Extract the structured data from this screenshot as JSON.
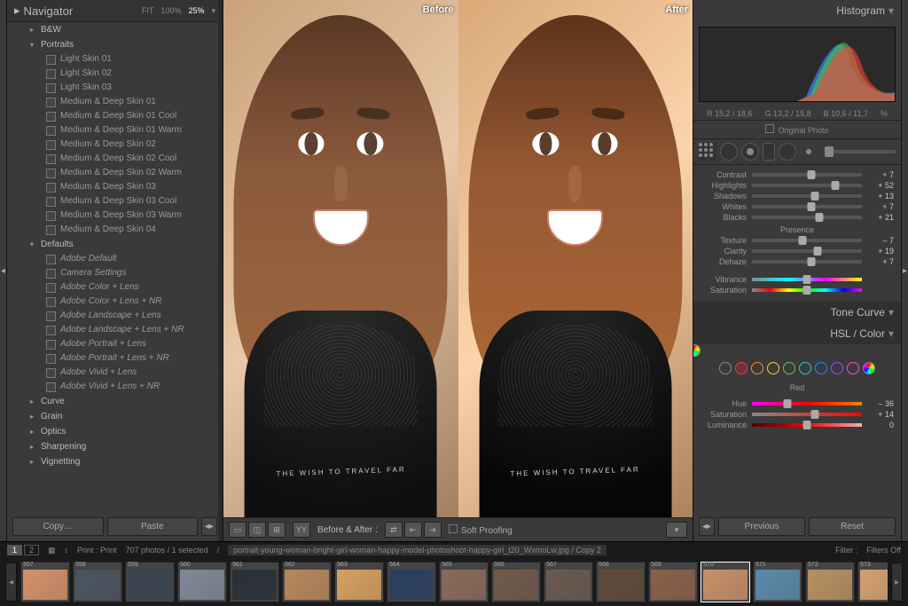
{
  "navigator": {
    "title": "Navigator",
    "zoom": {
      "fit": "FIT",
      "z100": "100%",
      "z25": "25%",
      "active": "25%"
    }
  },
  "presets": {
    "bw_section": "B&W",
    "portraits_section": "Portraits",
    "portraits": [
      "Light Skin 01",
      "Light Skin 02",
      "Light Skin 03",
      "Medium & Deep Skin 01",
      "Medium & Deep Skin 01 Cool",
      "Medium & Deep Skin 01 Warm",
      "Medium & Deep Skin 02",
      "Medium & Deep Skin 02 Cool",
      "Medium & Deep Skin 02 Warm",
      "Medium & Deep Skin 03",
      "Medium & Deep Skin 03 Cool",
      "Medium & Deep Skin 03 Warm",
      "Medium & Deep Skin 04"
    ],
    "defaults_section": "Defaults",
    "defaults": [
      "Adobe Default",
      "Camera Settings",
      "Adobe Color + Lens",
      "Adobe Color + Lens + NR",
      "Adobe Landscape + Lens",
      "Adobe Landscape + Lens + NR",
      "Adobe Portrait + Lens",
      "Adobe Portrait + Lens + NR",
      "Adobe Vivid + Lens",
      "Adobe Vivid + Lens + NR"
    ],
    "collapsed": [
      "Curve",
      "Grain",
      "Optics",
      "Sharpening",
      "Vignetting"
    ]
  },
  "left_buttons": {
    "copy": "Copy…",
    "paste": "Paste"
  },
  "compare": {
    "before": "Before",
    "after": "After",
    "shirt_text": "THE WISH TO TRAVEL FAR"
  },
  "bottom_toolbar": {
    "ba_label": "Before & After :",
    "soft_proof": "Soft Proofing"
  },
  "right": {
    "histogram_title": "Histogram",
    "hist_stats": {
      "r": "R  15,2 / 18,6",
      "g": "G  13,2 / 15,8",
      "b": "B  10,6 / 11,7",
      "pct": "%"
    },
    "original_photo": "Original Photo",
    "basic_sliders": [
      {
        "label": "Contrast",
        "val": "+ 7",
        "pos": 54
      },
      {
        "label": "Highlights",
        "val": "+ 52",
        "pos": 76
      },
      {
        "label": "Shadows",
        "val": "+ 13",
        "pos": 57
      },
      {
        "label": "Whites",
        "val": "+ 7",
        "pos": 54
      },
      {
        "label": "Blacks",
        "val": "+ 21",
        "pos": 61
      }
    ],
    "presence_label": "Presence",
    "presence_sliders": [
      {
        "label": "Texture",
        "val": "– 7",
        "pos": 46
      },
      {
        "label": "Clarity",
        "val": "+ 19",
        "pos": 60
      },
      {
        "label": "Dehaze",
        "val": "+ 7",
        "pos": 54
      }
    ],
    "color_sliders": [
      {
        "label": "Vibrance",
        "val": "",
        "pos": 50,
        "cls": "grad-vib"
      },
      {
        "label": "Saturation",
        "val": "",
        "pos": 50,
        "cls": "grad-sat"
      }
    ],
    "tone_curve_title": "Tone Curve",
    "hsl_title": "HSL / Color",
    "hsl_channel": "Red",
    "hsl_sliders": [
      {
        "label": "Hue",
        "val": "– 36",
        "pos": 32,
        "cls": "grad-hue"
      },
      {
        "label": "Saturation",
        "val": "+ 14",
        "pos": 57,
        "cls": "grad-satR"
      },
      {
        "label": "Luminance",
        "val": "0",
        "pos": 50,
        "cls": "grad-lumR"
      }
    ],
    "prev_btn": "Previous",
    "reset_btn": "Reset"
  },
  "status": {
    "page1": "1",
    "page2": "2",
    "breadcrumb": "Print : Print",
    "count": "707 photos / 1 selected",
    "path": "portrait-young-woman-bright-girl-woman-happy-model-photoshoot-happy-girl_t20_WxmoLw.jpg / Copy 2",
    "filter_label": "Filter :",
    "filter_value": "Filters Off"
  },
  "filmstrip": {
    "start": 557,
    "selected": 570
  },
  "hsl_colors": [
    "#ff3030",
    "#ff8c1a",
    "#ffd21a",
    "#46d246",
    "#1ad2d2",
    "#1a8cff",
    "#9a4dff",
    "#ff4dd2"
  ]
}
